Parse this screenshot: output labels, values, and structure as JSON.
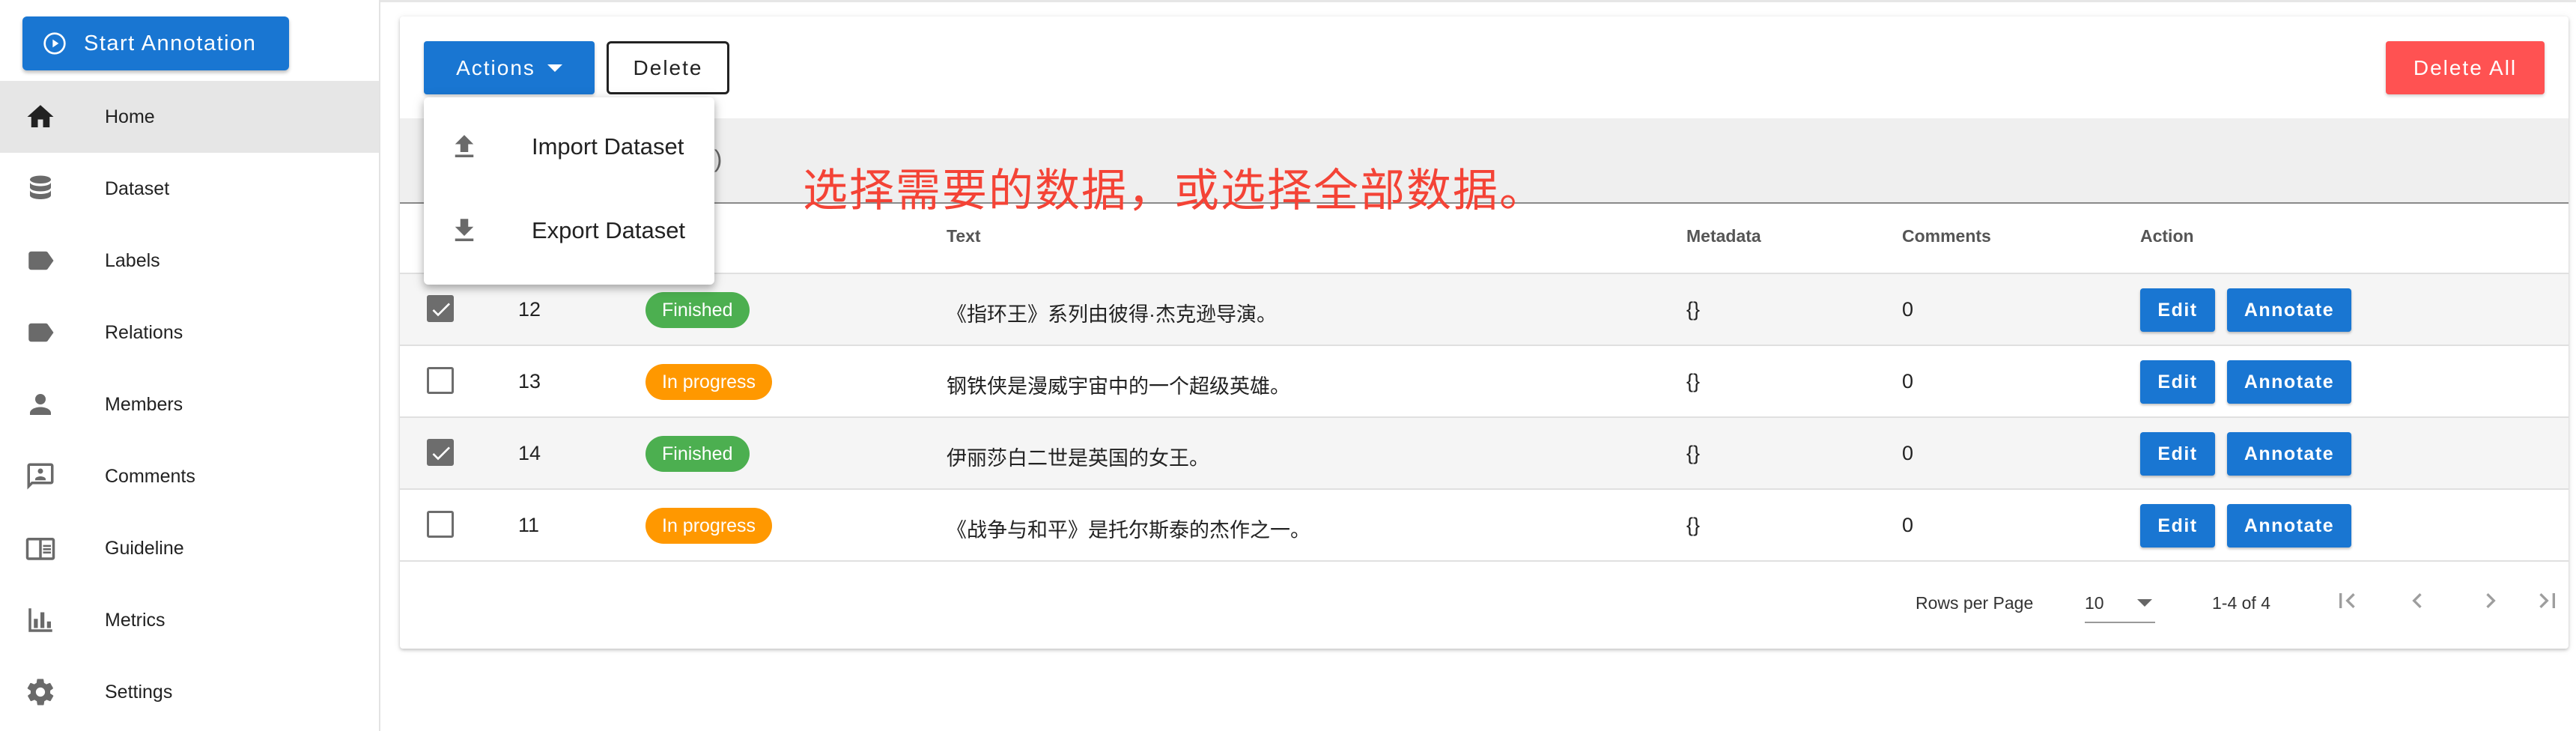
{
  "sidebar": {
    "start_button": "Start Annotation",
    "items": [
      {
        "label": "Home",
        "icon": "home-icon",
        "active": true
      },
      {
        "label": "Dataset",
        "icon": "database-icon"
      },
      {
        "label": "Labels",
        "icon": "label-icon"
      },
      {
        "label": "Relations",
        "icon": "label-icon"
      },
      {
        "label": "Members",
        "icon": "person-icon"
      },
      {
        "label": "Comments",
        "icon": "comment-icon"
      },
      {
        "label": "Guideline",
        "icon": "book-icon"
      },
      {
        "label": "Metrics",
        "icon": "bar-chart-icon"
      },
      {
        "label": "Settings",
        "icon": "gear-icon"
      }
    ]
  },
  "toolbar": {
    "actions_label": "Actions",
    "delete_label": "Delete",
    "delete_all_label": "Delete All"
  },
  "menu": {
    "import_label": "Import Dataset",
    "export_label": "Export Dataset"
  },
  "search": {
    "partial_hint": "ve)"
  },
  "annotation_text": "选择需要的数据，或选择全部数据。",
  "table": {
    "headers": {
      "text": "Text",
      "metadata": "Metadata",
      "comments": "Comments",
      "action": "Action"
    },
    "edit_label": "Edit",
    "annotate_label": "Annotate",
    "rows": [
      {
        "id": "12",
        "status": "Finished",
        "text": "《指环王》系列由彼得·杰克逊导演。",
        "metadata": "{}",
        "comments": "0",
        "selected": true
      },
      {
        "id": "13",
        "status": "In progress",
        "text": "钢铁侠是漫威宇宙中的一个超级英雄。",
        "metadata": "{}",
        "comments": "0",
        "selected": false
      },
      {
        "id": "14",
        "status": "Finished",
        "text": "伊丽莎白二世是英国的女王。",
        "metadata": "{}",
        "comments": "0",
        "selected": true
      },
      {
        "id": "11",
        "status": "In progress",
        "text": "《战争与和平》是托尔斯泰的杰作之一。",
        "metadata": "{}",
        "comments": "0",
        "selected": false
      }
    ]
  },
  "footer": {
    "rows_per_page_label": "Rows per Page",
    "rows_per_page_value": "10",
    "range": "1-4 of 4"
  },
  "colors": {
    "primary": "#1976d2",
    "danger": "#ff5252",
    "finished": "#4caf50",
    "in_progress": "#ff9800",
    "annotation": "#f44336"
  }
}
